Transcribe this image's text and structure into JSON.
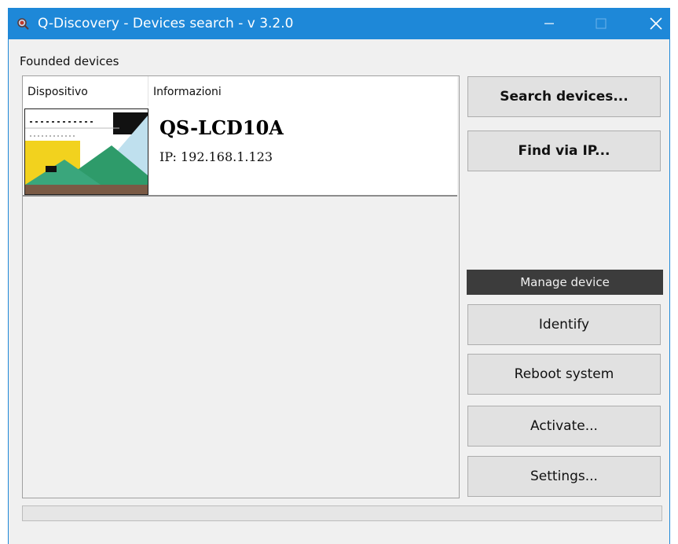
{
  "window": {
    "title": "Q-Discovery - Devices search - v 3.2.0",
    "accent_color": "#1e88d8",
    "icons": {
      "app": "magnifier-icon",
      "minimize": "minimize-icon",
      "maximize": "maximize-icon",
      "close": "close-icon"
    }
  },
  "devices_group": {
    "label": "Founded devices",
    "columns": [
      "Dispositivo",
      "Informazioni"
    ],
    "devices": [
      {
        "name": "QS-LCD10A",
        "ip": "IP: 192.168.1.123",
        "thumbnail_icon": "device-screen-thumbnail"
      }
    ]
  },
  "actions": {
    "search": "Search devices...",
    "find_ip": "Find via IP..."
  },
  "manage": {
    "header": "Manage device",
    "identify": "Identify",
    "reboot": "Reboot system",
    "activate": "Activate...",
    "settings": "Settings..."
  },
  "progress": {
    "value": 0
  }
}
